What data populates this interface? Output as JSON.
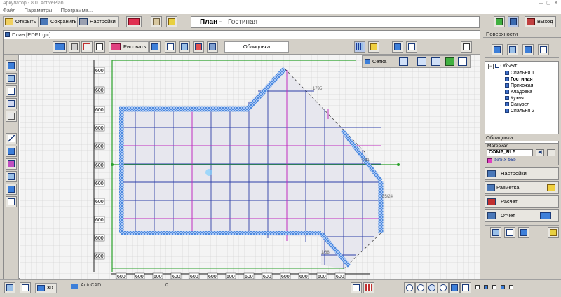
{
  "window": {
    "title": "Аркулатор - 8.0. ActivePlan"
  },
  "menu": [
    "Файл",
    "Параметры",
    "Программа..."
  ],
  "toolbar": {
    "open": "Открыть",
    "save": "Сохранить",
    "settings": "Настройки",
    "exit": "Выход"
  },
  "room": {
    "label": "План -",
    "name": "Гостиная"
  },
  "plan": {
    "title": "План [PDF1.glc]",
    "draw": "Рисовать",
    "facing": "Облицовка",
    "grid": "Сетка",
    "dim": "600",
    "dim_small": "1795",
    "dim_small2": "4:81",
    "dim_small3": "85/24",
    "dim_small4": "1/68"
  },
  "surfaces": {
    "header": "Поверхности",
    "root": "Объект",
    "items": [
      "Спальня 1",
      "Гостиная",
      "Прихожая",
      "Кладовка",
      "Кухня",
      "Санузел",
      "Спальня 2"
    ],
    "selected": "Гостиная"
  },
  "facing_panel": {
    "header": "Облицовка",
    "material_label": "Материал",
    "material": "COMP_RL5",
    "size": "585 x 585",
    "swatch_color": "#e040c0",
    "btn_settings": "Настройки",
    "btn_markup": "Разметка",
    "btn_calc": "Расчет",
    "btn_report": "Отчет"
  },
  "status": {
    "mode3d": "3D",
    "autocad": "AutoCAD",
    "count": "0"
  },
  "colors": {
    "wall_blue": "#3d7fd9",
    "grid_blue": "#2e3fa8",
    "grid_magenta": "#c02cc0",
    "axis_green": "#2aa02a"
  }
}
